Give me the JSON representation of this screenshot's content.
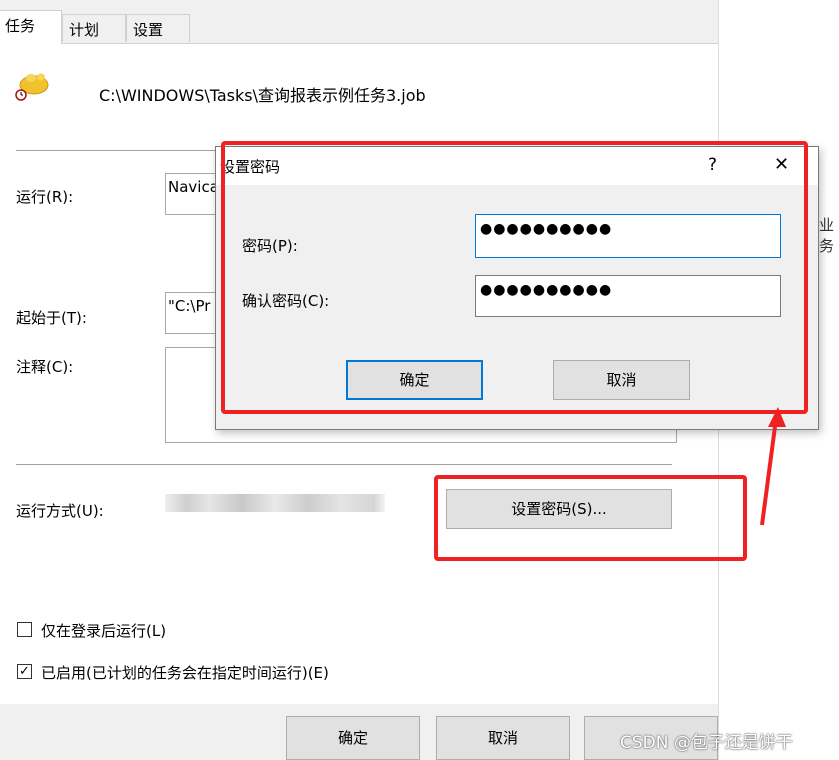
{
  "tabs": [
    {
      "label": "任务",
      "active": true
    },
    {
      "label": "计划",
      "active": false
    },
    {
      "label": "设置",
      "active": false
    }
  ],
  "task": {
    "path": "C:\\WINDOWS\\Tasks\\查询报表示例任务3.job",
    "icon": "scheduled-task-icon"
  },
  "form": {
    "run_label": "运行(R):",
    "run_value": "Navica",
    "start_label": "起始于(T):",
    "start_value": "\"C:\\Pr",
    "comment_label": "注释(C):",
    "run_as_label": "运行方式(U):",
    "set_password_button": "设置密码(S)...",
    "only_logged_on_label": "仅在登录后运行(L)",
    "enabled_label": "已启用(已计划的任务会在指定时间运行)(E)",
    "enabled_checked": true,
    "only_logged_on_checked": false
  },
  "footer": {
    "ok": "确定",
    "cancel": "取消"
  },
  "dialog": {
    "title": "设置密码",
    "help_glyph": "?",
    "close_glyph": "✕",
    "password_label": "密码(P):",
    "confirm_label": "确认密码(C):",
    "password_value": "●●●●●●●●●●",
    "confirm_value": "●●●●●●●●●●",
    "ok": "确定",
    "cancel": "取消"
  },
  "right_pane": {
    "partial_text": "业 务"
  },
  "watermark": "CSDN @包子还是饼干",
  "colors": {
    "annotation_red": "#ee2222",
    "focus_blue": "#0078d7"
  }
}
